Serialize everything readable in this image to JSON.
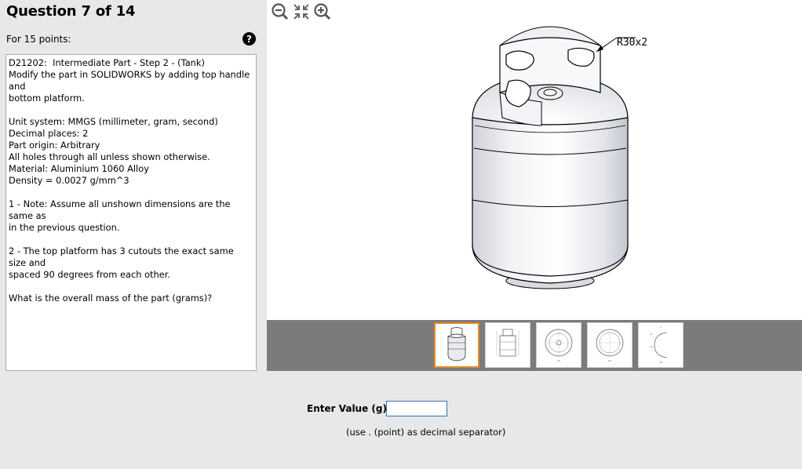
{
  "header": {
    "title": "Question 7 of 14",
    "points": "For 15 points:"
  },
  "question": {
    "lines": [
      "D21202:  Intermediate Part - Step 2 - (Tank)",
      "Modify the part in SOLIDWORKS by adding top handle and",
      "bottom platform.",
      "",
      "Unit system: MMGS (millimeter, gram, second)",
      "Decimal places: 2",
      "Part origin: Arbitrary",
      "All holes through all unless shown otherwise.",
      "Material: Aluminium 1060 Alloy",
      "Density = 0.0027 g/mm^3",
      "",
      "1 - Note: Assume all unshown dimensions are the same as",
      "in the previous question.",
      "",
      "2 - The top platform has 3 cutouts the exact same size and",
      "spaced 90 degrees from each other.",
      "",
      "What is the overall mass of the part (grams)?"
    ]
  },
  "viewer": {
    "tools": [
      "zoom-out-icon",
      "fit-to-window-icon",
      "zoom-in-icon"
    ],
    "dimension_label": "R30x2",
    "thumbnails": [
      {
        "name": "tank-isometric",
        "active": true
      },
      {
        "name": "tank-front-drawing",
        "active": false
      },
      {
        "name": "tank-top-drawing",
        "active": false
      },
      {
        "name": "tank-bottom-drawing",
        "active": false
      },
      {
        "name": "tank-section-drawing",
        "active": false
      }
    ]
  },
  "answer": {
    "label": "Enter Value (g):",
    "value": "",
    "hint": "(use . (point) as decimal separator)"
  },
  "colors": {
    "thumb_active_border": "#e08a2a",
    "thumb_strip": "#7b7b7b",
    "input_border": "#3c6fb0"
  }
}
